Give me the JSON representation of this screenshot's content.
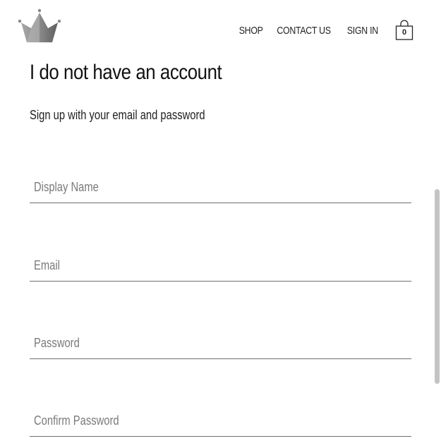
{
  "header": {
    "logo_icon": "crown-icon",
    "nav": {
      "shop": "SHOP",
      "contact": "CONTACT US",
      "signin": "SIGN IN"
    },
    "cart": {
      "icon": "shopping-bag-icon",
      "count": "0"
    }
  },
  "signup": {
    "title": "I do not have an account",
    "subtitle": "Sign up with your email and password",
    "fields": [
      {
        "label": "Display Name",
        "value": ""
      },
      {
        "label": "Email",
        "value": ""
      },
      {
        "label": "Password",
        "value": ""
      },
      {
        "label": "Confirm Password",
        "value": ""
      }
    ]
  },
  "colors": {
    "text": "#222222",
    "label": "#7a7a7a",
    "underline": "#6e6e6e",
    "logo_gray": "#808080"
  }
}
